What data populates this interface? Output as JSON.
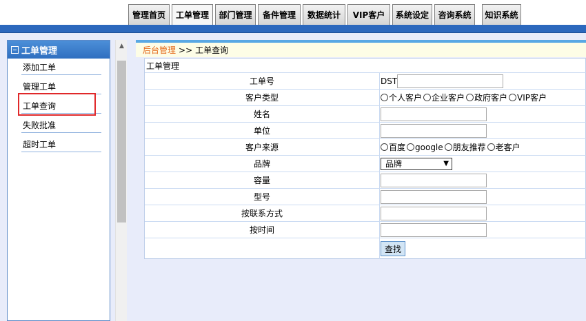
{
  "topnav": [
    {
      "label": "管理首页",
      "name": "nav-home"
    },
    {
      "label": "工单管理",
      "name": "nav-ticket-management"
    },
    {
      "label": "部门管理",
      "name": "nav-department"
    },
    {
      "label": "备件管理",
      "name": "nav-spare-parts"
    },
    {
      "label": "数据统计",
      "name": "nav-statistics"
    },
    {
      "label": "VIP客户",
      "name": "nav-vip"
    },
    {
      "label": "系统设定",
      "name": "nav-settings"
    },
    {
      "label": "咨询系统",
      "name": "nav-consult"
    },
    {
      "label": "知识系统",
      "name": "nav-knowledge"
    }
  ],
  "sidebar": {
    "title": "工单管理",
    "items": [
      "添加工单",
      "管理工单",
      "工单查询",
      "失败批准",
      "超时工单"
    ]
  },
  "breadcrumb": {
    "root": "后台管理",
    "separator": ">>",
    "current": "工单查询"
  },
  "panel_title": "工单管理",
  "form": {
    "ticket_no_label": "工单号",
    "ticket_no_prefix": "DST",
    "customer_type_label": "客户类型",
    "customer_types": [
      "个人客户",
      "企业客户",
      "政府客户",
      "VIP客户"
    ],
    "name_label": "姓名",
    "unit_label": "单位",
    "source_label": "客户来源",
    "sources": [
      "百度",
      "google",
      "朋友推荐",
      "老客户"
    ],
    "brand_label": "品牌",
    "brand_selected": "品牌",
    "capacity_label": "容量",
    "model_label": "型号",
    "contact_label": "按联系方式",
    "time_label": "按时间",
    "submit_label": "查找"
  }
}
